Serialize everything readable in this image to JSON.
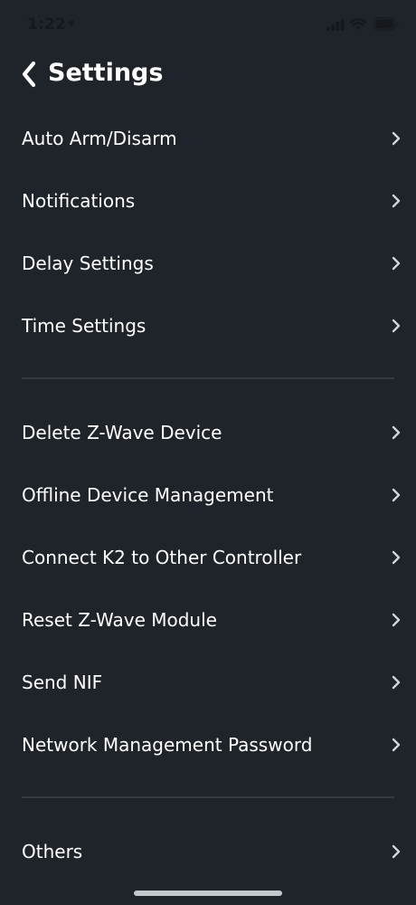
{
  "status_bar": {
    "time": "1:22"
  },
  "header": {
    "title": "Settings"
  },
  "groups": [
    {
      "items": [
        {
          "label": "Auto Arm/Disarm"
        },
        {
          "label": "Notifications"
        },
        {
          "label": "Delay Settings"
        },
        {
          "label": "Time Settings"
        }
      ]
    },
    {
      "items": [
        {
          "label": "Delete Z-Wave Device"
        },
        {
          "label": "Offline Device Management"
        },
        {
          "label": "Connect K2 to Other Controller"
        },
        {
          "label": "Reset Z-Wave Module"
        },
        {
          "label": "Send NIF"
        },
        {
          "label": "Network Management Password"
        }
      ]
    },
    {
      "items": [
        {
          "label": "Others"
        }
      ]
    }
  ],
  "colors": {
    "background": "#1f232a",
    "text": "#ffffff",
    "divider": "#343a43",
    "chevron": "#d0d3d8"
  },
  "icons": {
    "back": "chevron-left-icon",
    "row": "chevron-right-icon"
  }
}
